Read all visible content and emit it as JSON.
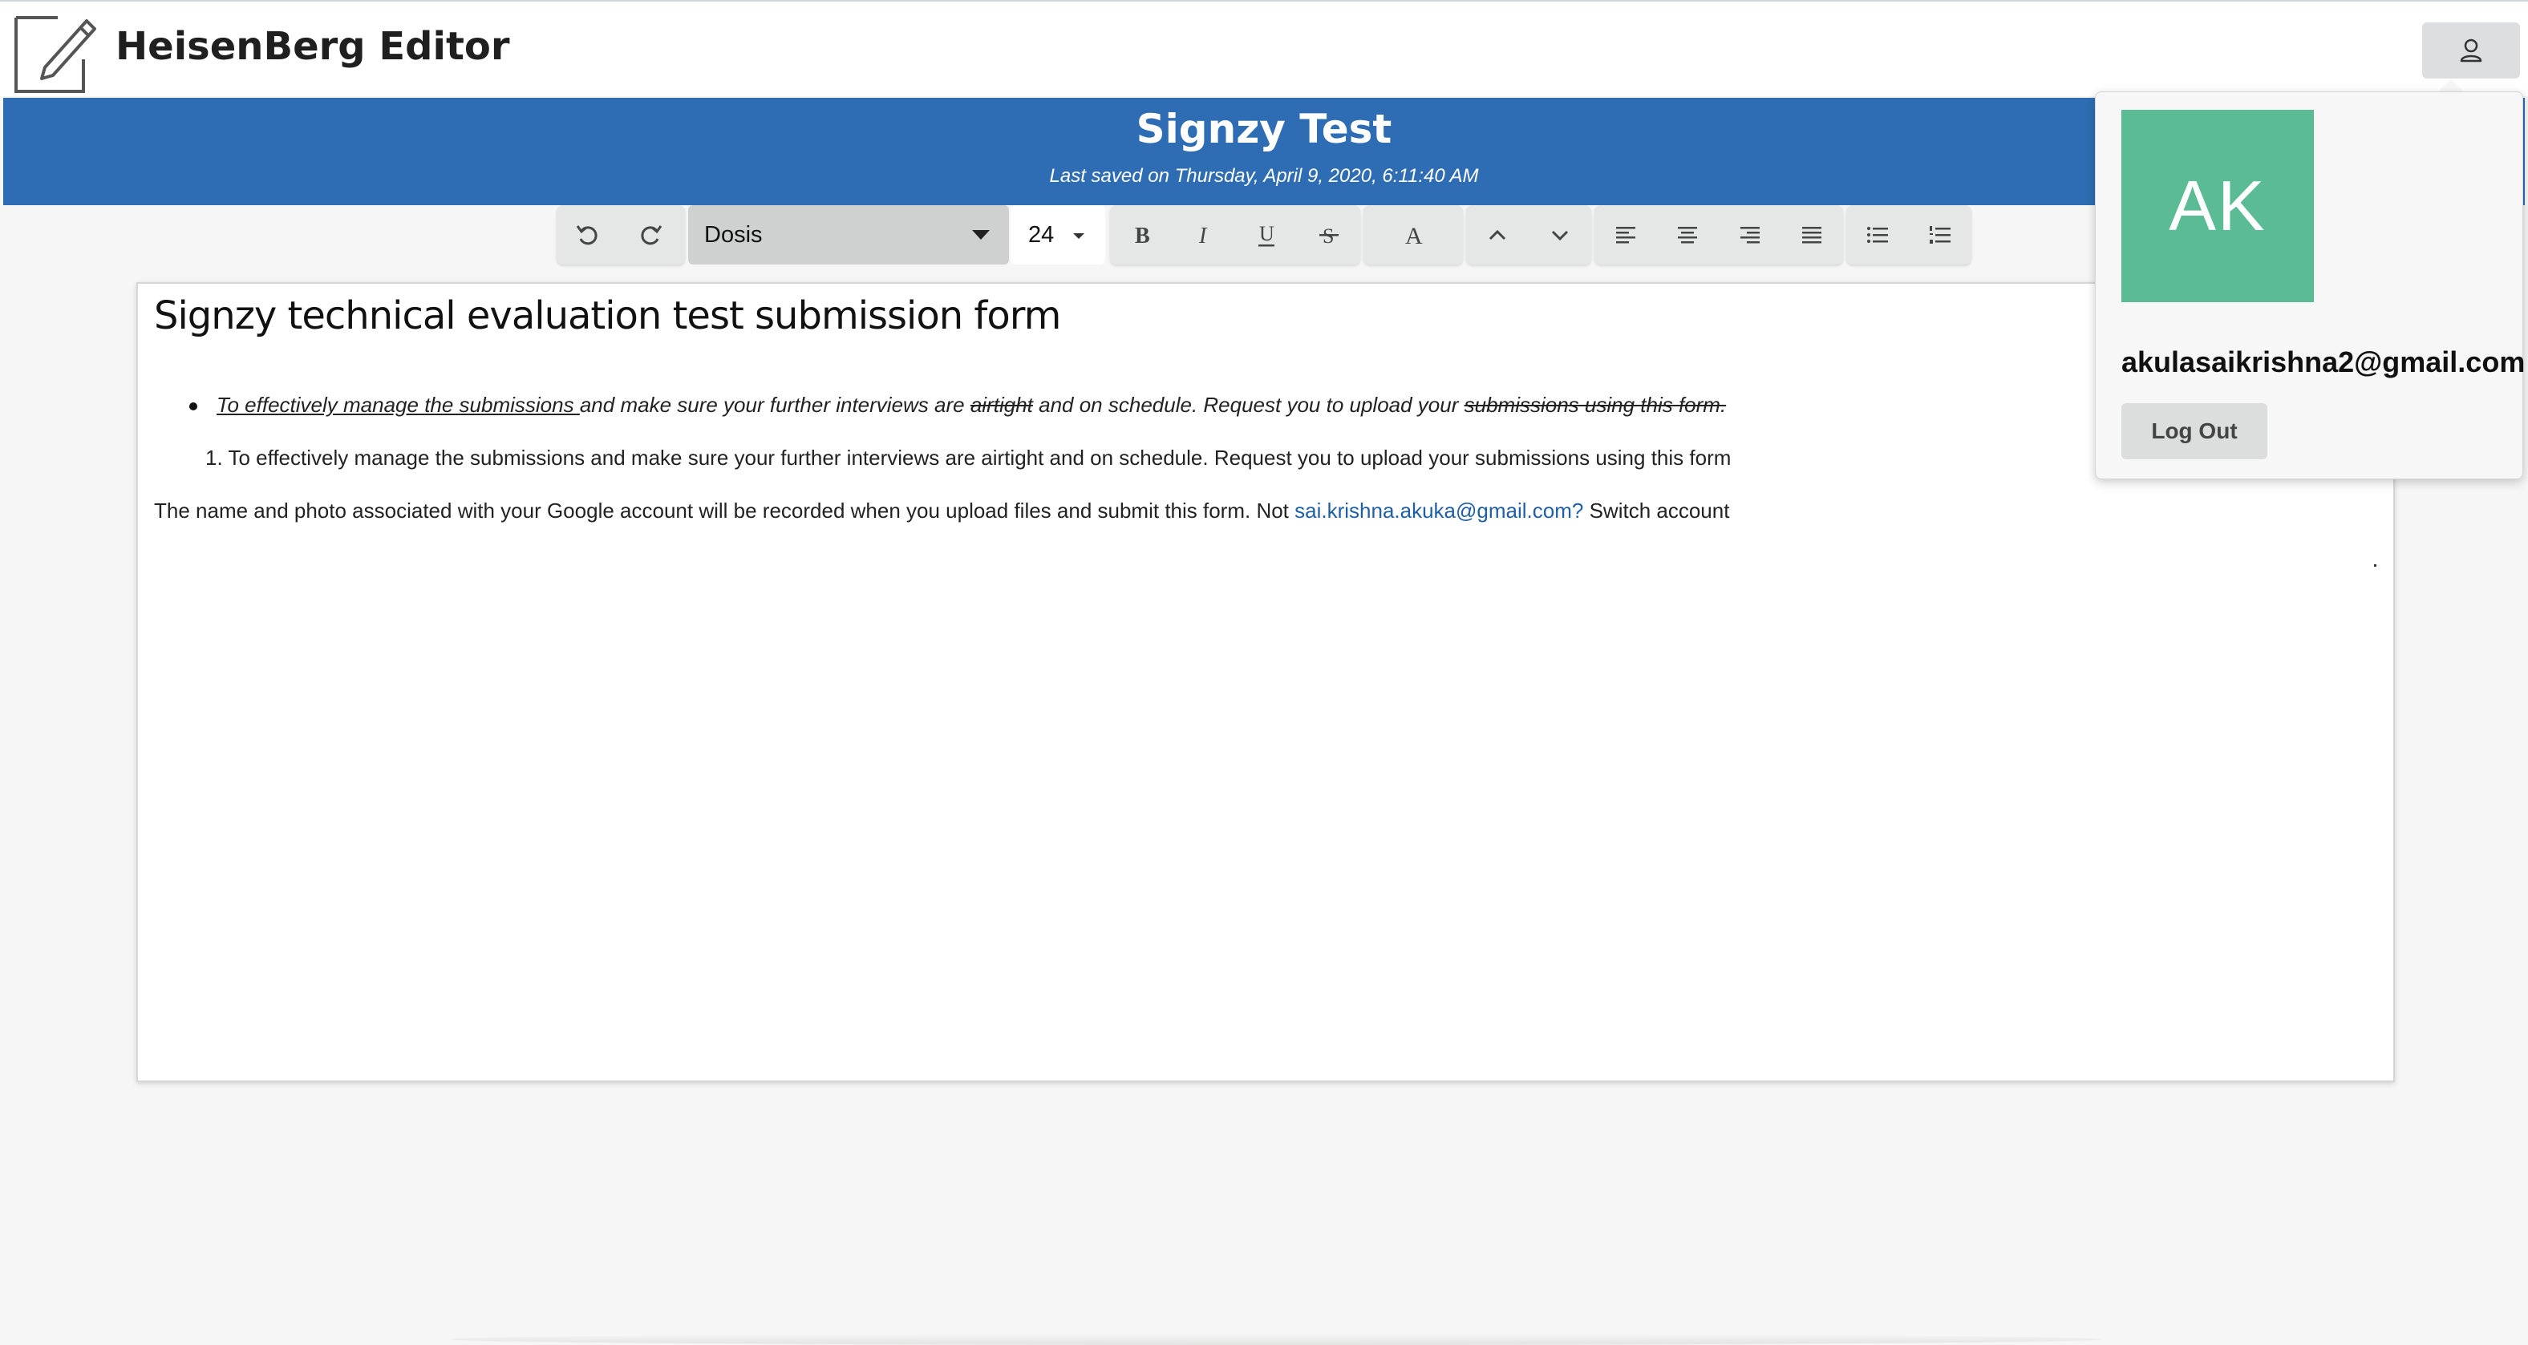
{
  "header": {
    "app_title": "HeisenBerg Editor",
    "logo_icon": "edit-document-icon",
    "user_button_icon": "user-icon"
  },
  "document": {
    "title": "Signzy Test",
    "last_saved": "Last saved on Thursday, April 9, 2020, 6:11:40 AM"
  },
  "toolbar": {
    "undo_icon": "undo-icon",
    "redo_icon": "redo-icon",
    "font_family": "Dosis",
    "font_size": "24",
    "buttons": [
      "bold-icon",
      "italic-icon",
      "underline-icon",
      "strikethrough-icon",
      "text-color-icon",
      "chevron-up-icon",
      "chevron-down-icon",
      "align-left-icon",
      "align-center-icon",
      "align-right-icon",
      "align-justify-icon",
      "bullet-list-icon",
      "numbered-list-icon"
    ]
  },
  "content": {
    "heading": "Signzy technical evaluation test submission form",
    "bullet": {
      "underlined_part": "To effectively manage the submissions ",
      "part2": "and make sure your further interviews are ",
      "struck_word": "airtight",
      "part3": " and on schedule. Request you to  upload your ",
      "struck_tail": "submissions using this form."
    },
    "numbered_item": "1. To effectively manage the submissions and make sure your further interviews are airtight and on schedule. Request you to  upload your submissions using this form",
    "plain_line_before": "The name and photo associated with your Google account will be recorded when you upload files and submit this form. Not ",
    "plain_line_link": "sai.krishna.akuka@gmail.com?",
    "plain_line_after": " Switch account"
  },
  "account_popup": {
    "avatar_initials": "AK",
    "avatar_color": "#5bbb94",
    "email": "akulasaikrishna2@gmail.com",
    "logout_label": "Log Out"
  },
  "colors": {
    "banner": "#2e6db4",
    "link": "#1f5fa8"
  }
}
